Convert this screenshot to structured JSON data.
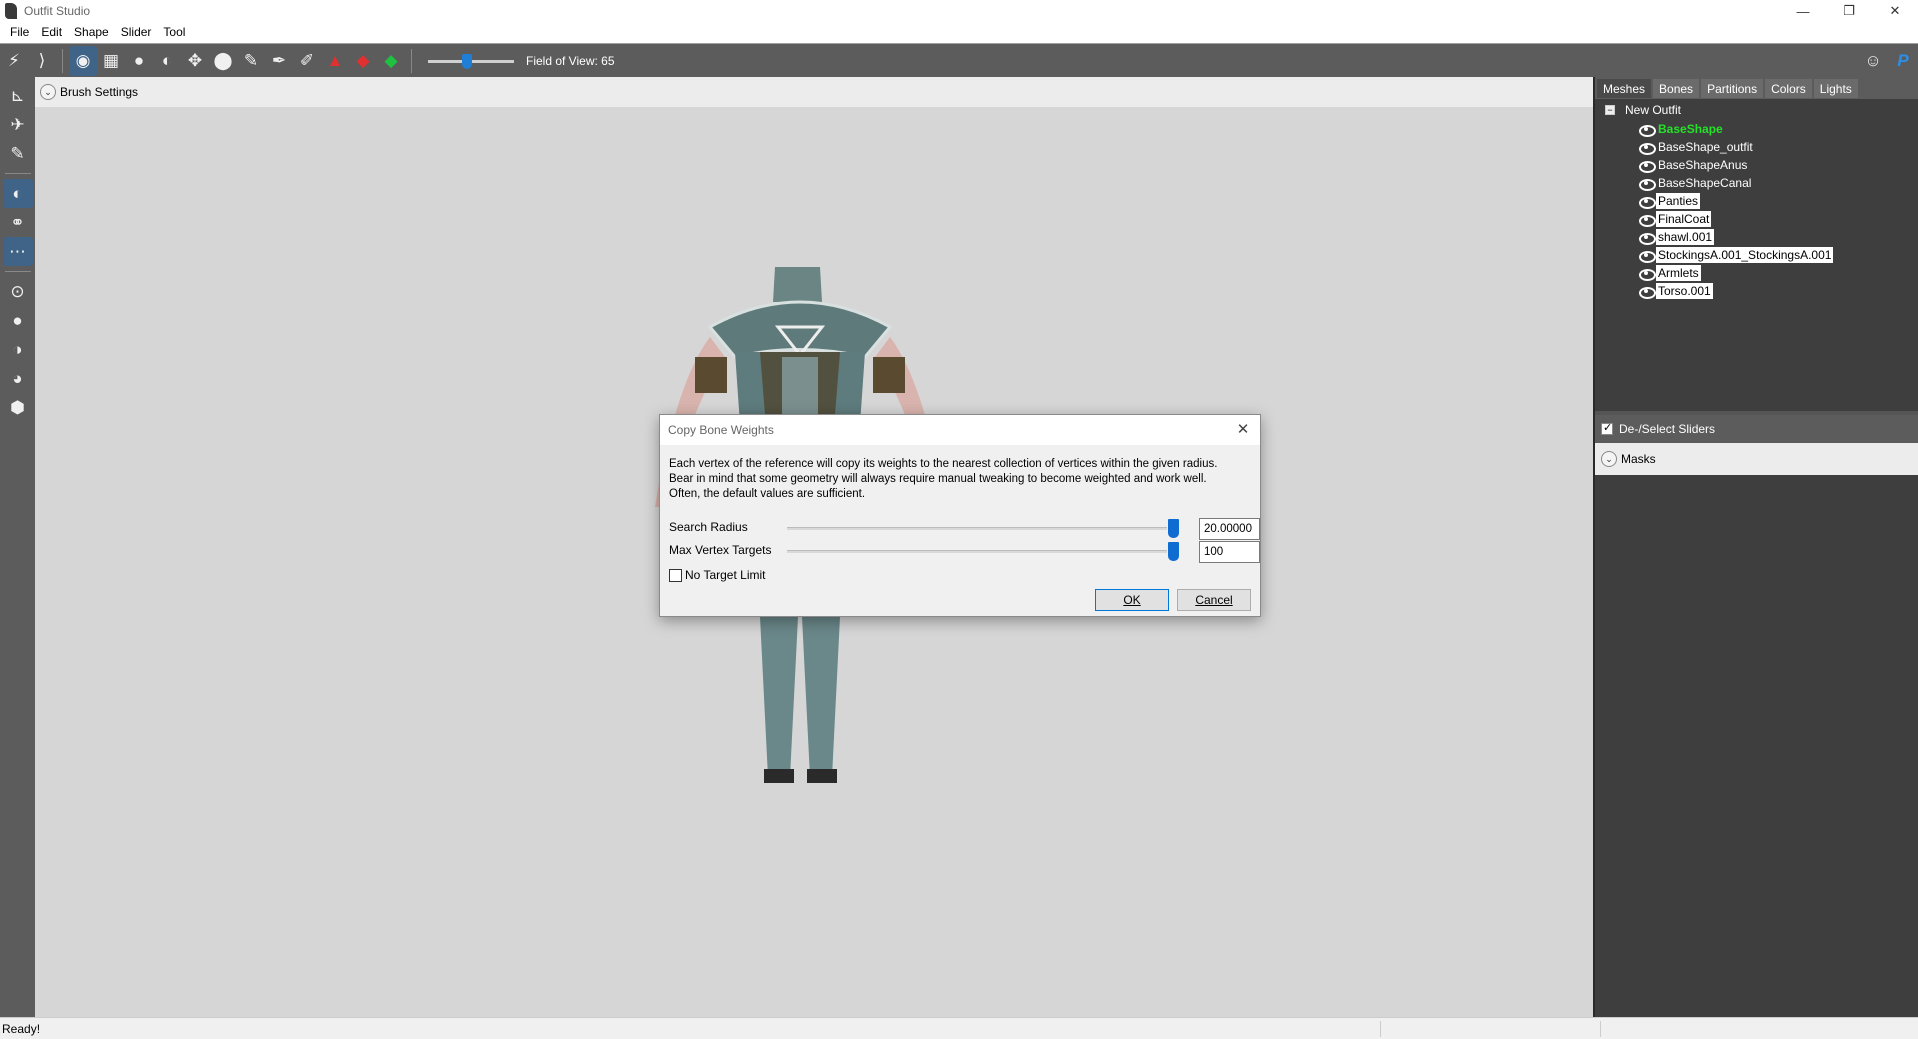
{
  "window": {
    "title": "Outfit Studio",
    "controls": {
      "minimize": "—",
      "restore": "❐",
      "close": "✕"
    }
  },
  "menu": {
    "items": [
      "File",
      "Edit",
      "Shape",
      "Slider",
      "Tool"
    ]
  },
  "toolbar": {
    "field_of_view_label": "Field of View: 65",
    "field_of_view_value": 65,
    "icons": [
      "select-brush-icon",
      "mask-brush-icon",
      "inflate-brush-icon",
      "deflate-brush-icon",
      "move-brush-icon",
      "smooth-brush-icon",
      "undiff-brush-icon",
      "weight-brush-icon",
      "color-brush-icon",
      "alpha-brush-icon",
      "collapse-vertex-icon",
      "flip-edge-icon",
      "split-edge-icon"
    ],
    "right_icons": [
      "discord-icon",
      "paypal-icon"
    ]
  },
  "viewport": {
    "brush_settings_label": "Brush Settings"
  },
  "right_panel": {
    "tabs": [
      "Meshes",
      "Bones",
      "Partitions",
      "Colors",
      "Lights"
    ],
    "active_tab": "Meshes",
    "tree_root": "New Outfit",
    "meshes": [
      {
        "name": "BaseShape",
        "state": "selected"
      },
      {
        "name": "BaseShape_outfit",
        "state": "normal"
      },
      {
        "name": "BaseShapeAnus",
        "state": "normal"
      },
      {
        "name": "BaseShapeCanal",
        "state": "normal"
      },
      {
        "name": "Panties",
        "state": "highlighted"
      },
      {
        "name": "FinalCoat",
        "state": "highlighted"
      },
      {
        "name": "shawl.001",
        "state": "highlighted"
      },
      {
        "name": "StockingsA.001_StockingsA.001",
        "state": "highlighted"
      },
      {
        "name": "Armlets",
        "state": "highlighted"
      },
      {
        "name": "Torso.001",
        "state": "highlighted"
      }
    ],
    "select_sliders_label": "De-/Select Sliders",
    "masks_label": "Masks"
  },
  "dialog": {
    "title": "Copy Bone Weights",
    "description": "Each vertex of the reference will copy its weights to the nearest collection of vertices within the given radius. Bear in mind that some geometry will always require manual tweaking to become weighted and work well. Often, the default values are sufficient.",
    "search_radius_label": "Search Radius",
    "search_radius_value": "20.00000",
    "max_vertex_targets_label": "Max Vertex Targets",
    "max_vertex_targets_value": "100",
    "no_target_limit_label": "No Target Limit",
    "ok_label": "OK",
    "cancel_label": "Cancel"
  },
  "status": {
    "text": "Ready!"
  }
}
